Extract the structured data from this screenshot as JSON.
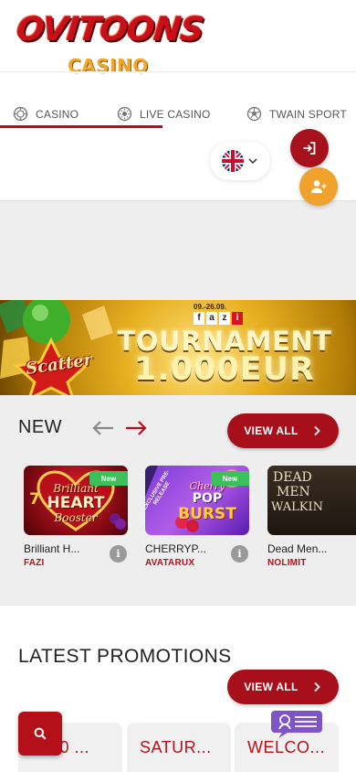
{
  "brand": {
    "name": "OVITOONS",
    "sub": "CASINO"
  },
  "nav": {
    "items": [
      {
        "label": "CASINO",
        "icon": "casino-chip-icon"
      },
      {
        "label": "LIVE CASINO",
        "icon": "live-casino-icon"
      },
      {
        "label": "TWAIN SPORT",
        "icon": "sport-ball-icon"
      }
    ]
  },
  "language": {
    "flag": "uk-flag-icon"
  },
  "banner": {
    "date": "09.-26.09.",
    "brand_letters": [
      "f",
      "a",
      "z",
      "i"
    ],
    "title": "TOURNAMENT",
    "amount": "1.000EUR",
    "game": "Scatter"
  },
  "new_section": {
    "title": "NEW",
    "view_all": "VIEW ALL"
  },
  "games": [
    {
      "name": "Brilliant H...",
      "provider": "FAZI",
      "badge": "New",
      "art_top": "Brilliant",
      "art_mid": "HEART",
      "art_bot": "Booster"
    },
    {
      "name": "CHERRYP...",
      "provider": "AVATARUX",
      "badge": "New",
      "ribbon": "EXCLUSIVE PRE-RELEASE",
      "art_top": "Cherry",
      "art_mid": "POP",
      "art_bot": "BURST"
    },
    {
      "name": "Dead Men...",
      "provider": "NOLIMIT",
      "art_top": "DEAD",
      "art_mid": "MEN",
      "art_bot": "WALKIN"
    }
  ],
  "info_glyph": "i",
  "promotions": {
    "title": "LATEST PROMOTIONS",
    "view_all": "VIEW ALL",
    "cards": [
      "1000 ...",
      "SATUR...",
      "WELCO..."
    ]
  },
  "colors": {
    "brand_red": "#a7101b",
    "brand_orange": "#f0a22c",
    "new_green": "#3cc05a",
    "provider_red": "#b3131d"
  }
}
